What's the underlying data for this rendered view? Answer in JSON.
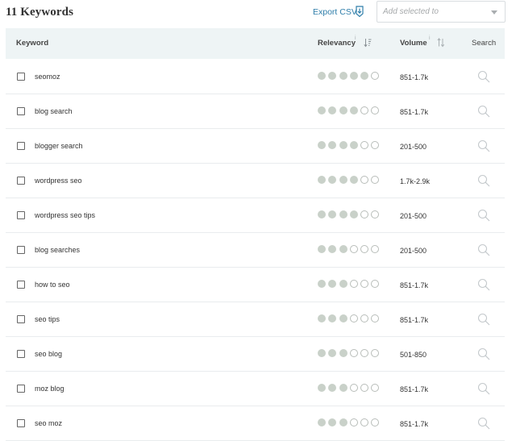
{
  "header": {
    "title": "11 Keywords",
    "export_label": "Export CSV",
    "add_selected_placeholder": "Add selected to"
  },
  "table": {
    "columns": {
      "keyword": "Keyword",
      "relevancy": "Relevancy",
      "volume": "Volume",
      "search": "Search"
    },
    "rows": [
      {
        "keyword": "seomoz",
        "relevancy": 5,
        "volume": "851-1.7k"
      },
      {
        "keyword": "blog search",
        "relevancy": 4,
        "volume": "851-1.7k"
      },
      {
        "keyword": "blogger search",
        "relevancy": 4,
        "volume": "201-500"
      },
      {
        "keyword": "wordpress seo",
        "relevancy": 4,
        "volume": "1.7k-2.9k"
      },
      {
        "keyword": "wordpress seo tips",
        "relevancy": 4,
        "volume": "201-500"
      },
      {
        "keyword": "blog searches",
        "relevancy": 3,
        "volume": "201-500"
      },
      {
        "keyword": "how to seo",
        "relevancy": 3,
        "volume": "851-1.7k"
      },
      {
        "keyword": "seo tips",
        "relevancy": 3,
        "volume": "851-1.7k"
      },
      {
        "keyword": "seo blog",
        "relevancy": 3,
        "volume": "501-850"
      },
      {
        "keyword": "moz blog",
        "relevancy": 3,
        "volume": "851-1.7k"
      },
      {
        "keyword": "seo moz",
        "relevancy": 3,
        "volume": "851-1.7k"
      }
    ],
    "relevancy_max": 6
  },
  "icons": {
    "export": "download-icon",
    "dropdown": "chevron-down-icon",
    "sort": "sort-icon",
    "info": "info-icon",
    "search": "search-icon"
  },
  "colors": {
    "link": "#2f7eaa",
    "header_bg": "#eef4f5",
    "dot_filled": "#c9d1c9",
    "dot_empty_border": "#b8bdb9"
  }
}
